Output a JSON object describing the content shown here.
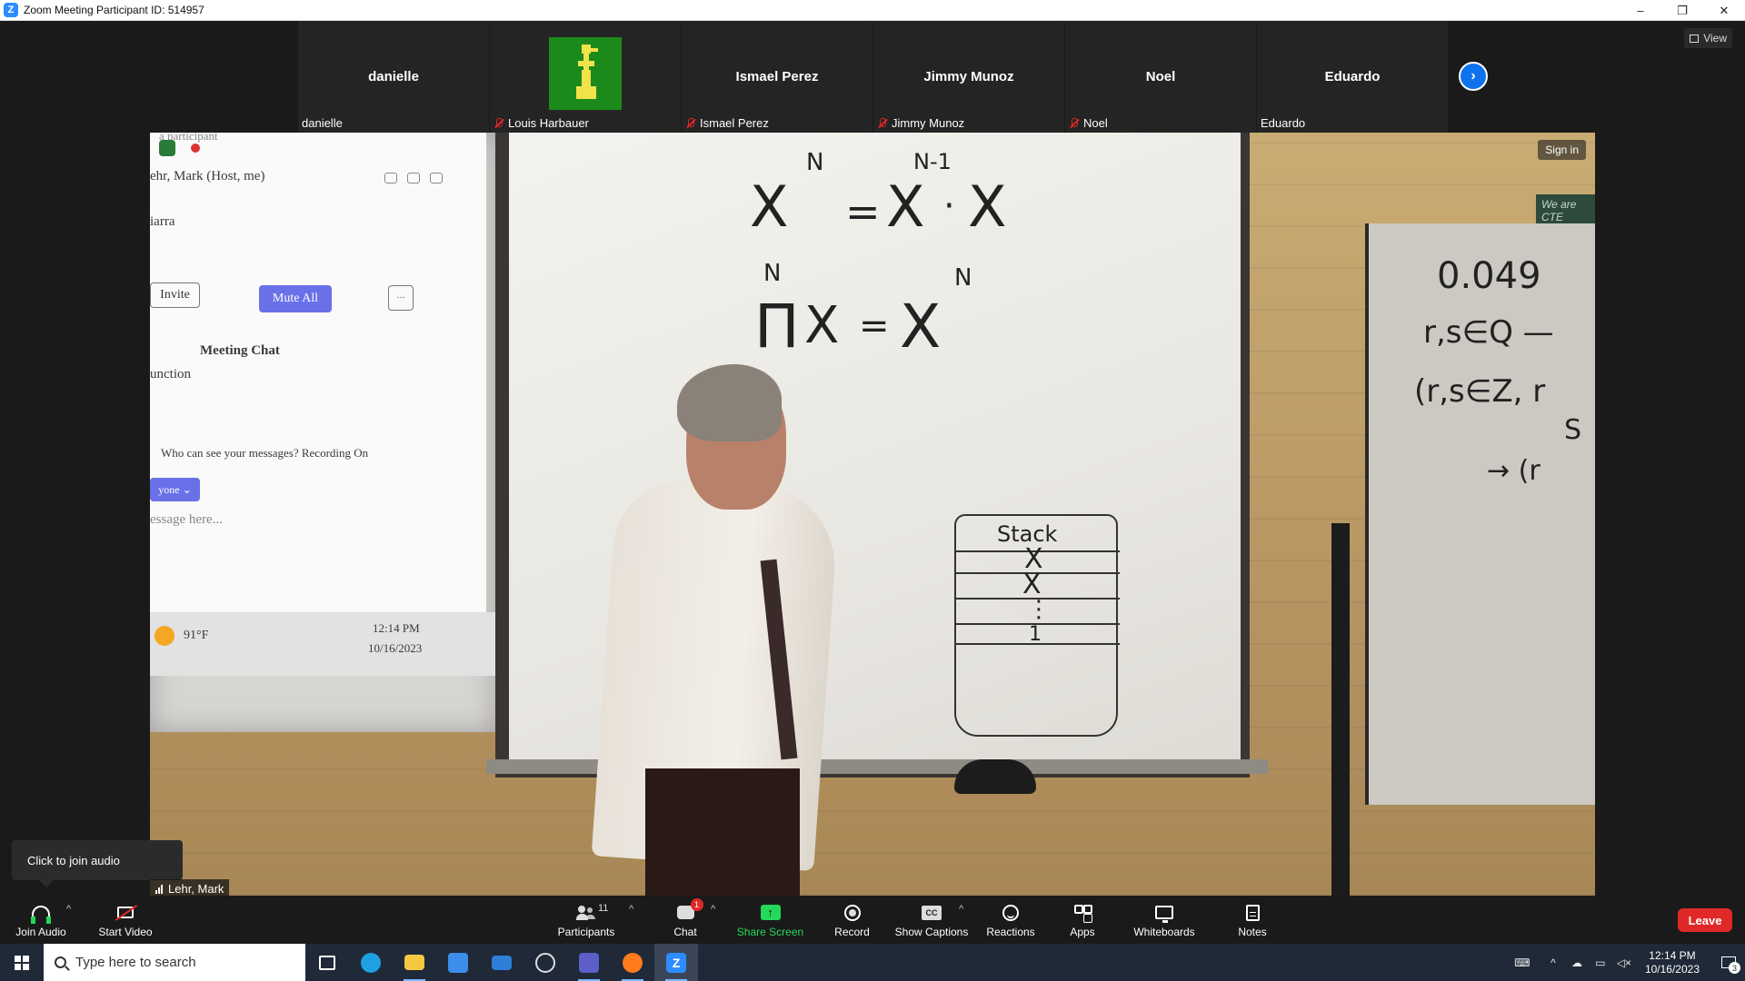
{
  "window": {
    "title": "Zoom Meeting Participant ID: 514957",
    "controls": [
      "–",
      "❐",
      "✕"
    ]
  },
  "participants_strip": [
    {
      "display": "danielle",
      "label": "danielle",
      "muted": false
    },
    {
      "display": "",
      "label": "Louis Harbauer",
      "muted": true,
      "avatar": "pixel-bird-image"
    },
    {
      "display": "Ismael Perez",
      "label": "Ismael Perez",
      "muted": true
    },
    {
      "display": "Jimmy Munoz",
      "label": "Jimmy Munoz",
      "muted": true
    },
    {
      "display": "Noel",
      "label": "Noel",
      "muted": true
    },
    {
      "display": "Eduardo",
      "label": "Eduardo",
      "muted": false
    }
  ],
  "view_button": "View",
  "video": {
    "sign_in": "Sign in",
    "speaker_label": "Lehr, Mark",
    "projection": {
      "participant_header": "a participant",
      "host_row": "ehr, Mark (Host, me)",
      "row2": "iarra",
      "invite": "Invite",
      "mute_all": "Mute All",
      "more": "···",
      "meeting_chat": "Meeting Chat",
      "function_text": "unction",
      "who_can_see": "Who can see your messages? Recording On",
      "recipient": "yone ⌄",
      "message_placeholder": "essage here...",
      "weather": "91°F",
      "time": "12:14 PM",
      "date": "10/16/2023"
    },
    "whiteboard": {
      "eq1_left": "X",
      "eq1_left_exp": "N",
      "eq1_eq": "=",
      "eq1_mid": "X",
      "eq1_mid_exp": "N-1",
      "eq1_dot": "·",
      "eq1_right": "X",
      "eq2_pi": "Π",
      "eq2_pi_sup": "N",
      "eq2_x": "X",
      "eq2_eq": "=",
      "eq2_right": "X",
      "eq2_right_exp": "N",
      "stack_title": "Stack",
      "stack_x1": "X",
      "stack_x2": "X",
      "stack_dots": "⋮",
      "stack_one": "1"
    },
    "right_board": {
      "line1": "0.049",
      "line2": "r,s∈Q —",
      "line3": "(r,s∈Z, r",
      "line4": "S",
      "line5": "→ (r"
    },
    "green_sign": "We are CTE"
  },
  "audio_tip": "Click to join audio",
  "toolbar": {
    "join_audio": "Join Audio",
    "start_video": "Start Video",
    "participants": "Participants",
    "participants_count": "11",
    "chat": "Chat",
    "chat_badge": "1",
    "share_screen": "Share Screen",
    "record": "Record",
    "show_captions": "Show Captions",
    "captions_icon": "CC",
    "reactions": "Reactions",
    "apps": "Apps",
    "whiteboards": "Whiteboards",
    "notes": "Notes",
    "leave": "Leave"
  },
  "taskbar": {
    "search_placeholder": "Type here to search",
    "apps": [
      {
        "name": "task-view-icon",
        "color": "#ffffff"
      },
      {
        "name": "edge-icon",
        "color": "#1fa0e0"
      },
      {
        "name": "file-explorer-icon",
        "color": "#f5c842"
      },
      {
        "name": "store-icon",
        "color": "#3c8ee8"
      },
      {
        "name": "mail-icon",
        "color": "#2f7fd8"
      },
      {
        "name": "vscode-like-icon",
        "color": "#dddddd"
      },
      {
        "name": "teams-icon",
        "color": "#5b5fc7"
      },
      {
        "name": "firefox-icon",
        "color": "#ff7b1c"
      },
      {
        "name": "zoom-icon",
        "color": "#2d8cff"
      }
    ],
    "time": "12:14 PM",
    "date": "10/16/2023",
    "notifications": "3"
  },
  "colors": {
    "zoom_blue": "#0e72ed",
    "leave_red": "#e02828",
    "share_green": "#23d959"
  }
}
